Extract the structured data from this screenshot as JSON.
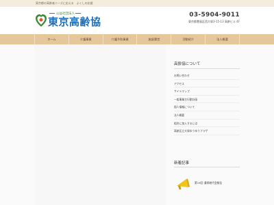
{
  "topbar": {
    "text": "東京都の高齢者ニーズに応える　よくしの応援"
  },
  "header": {
    "logo_sub": "公益社団法人",
    "logo_main": "東京高齢協",
    "phone": "03-5904-9011",
    "address": "東京都豊島区西大塚3-15-13 高齢ビル 4F"
  },
  "nav": {
    "items": [
      {
        "label": "ホーム"
      },
      {
        "label": "介護事業"
      },
      {
        "label": "介護予防事業"
      },
      {
        "label": "施設運営"
      },
      {
        "label": "活動紹介"
      },
      {
        "label": "法人概要"
      }
    ]
  },
  "sidebar": {
    "title": "高齢協について",
    "items": [
      {
        "label": "お問い合わせ"
      },
      {
        "label": "アクセス"
      },
      {
        "label": "サイトマップ"
      },
      {
        "label": "一般事業主行動計画"
      },
      {
        "label": "個人情報について"
      },
      {
        "label": "法人概要"
      },
      {
        "label": "組合に加入するには"
      },
      {
        "label": "高齢区立大塚ゆうゆうプラザ"
      }
    ]
  },
  "new_posts": {
    "title": "新着記事",
    "items": [
      {
        "title": "第16回 通常総代会報告"
      }
    ]
  },
  "colors": {
    "nav_bg": "#e6c79c",
    "topbar_bg": "#f4ecdc",
    "logo_blue": "#1e6fb8",
    "logo_green": "#3b8a2e",
    "megaphone": "#f0c419"
  }
}
